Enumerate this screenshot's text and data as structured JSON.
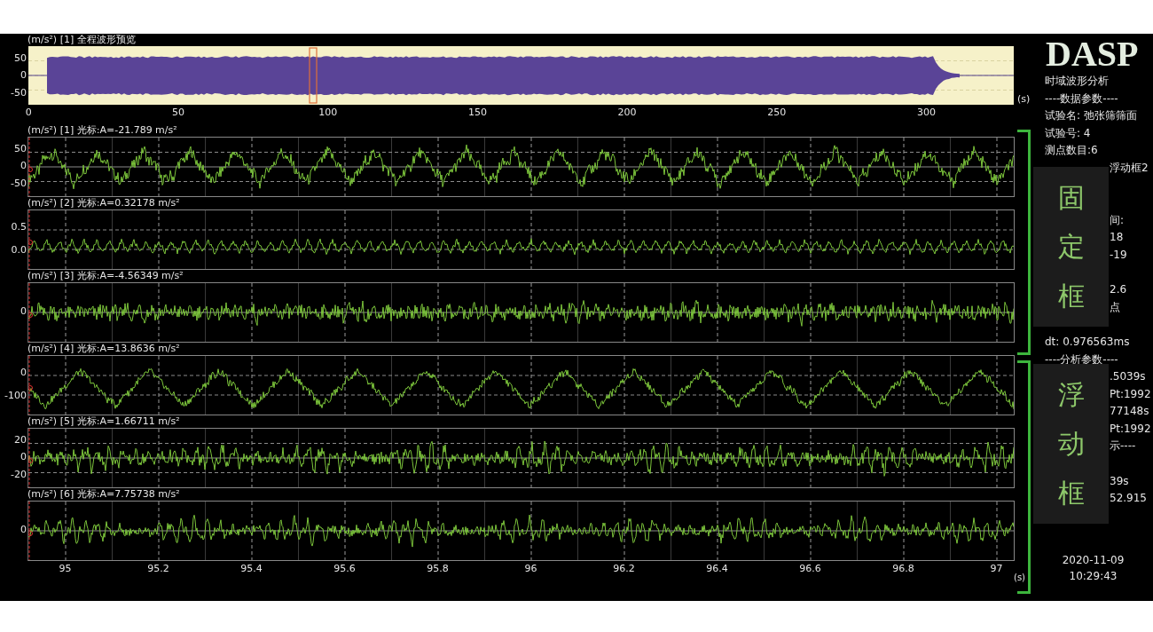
{
  "overview": {
    "label": "(m/s²) [1] 全程波形预览",
    "yticks": [
      "50",
      "0",
      "-50"
    ],
    "xticks": [
      "0",
      "50",
      "100",
      "150",
      "200",
      "250",
      "300"
    ],
    "unit": "(s)"
  },
  "channels": [
    {
      "label": "(m/s²) [1] 光标:A=-21.789 m/s²",
      "yticks": [
        "50",
        "0",
        "-50"
      ]
    },
    {
      "label": "(m/s²) [2] 光标:A=0.32178 m/s²",
      "yticks": [
        "0.5",
        "0.0"
      ]
    },
    {
      "label": "(m/s²) [3] 光标:A=-4.56349 m/s²",
      "yticks": [
        "0"
      ]
    },
    {
      "label": "(m/s²) [4] 光标:A=13.8636 m/s²",
      "yticks": [
        "0",
        "-100"
      ]
    },
    {
      "label": "(m/s²) [5] 光标:A=1.66711 m/s²",
      "yticks": [
        "20",
        "0",
        "-20"
      ]
    },
    {
      "label": "(m/s²) [6] 光标:A=7.75738 m/s²",
      "yticks": [
        "0"
      ]
    }
  ],
  "time_axis": {
    "ticks": [
      "95",
      "95.2",
      "95.4",
      "95.6",
      "95.8",
      "96",
      "96.2",
      "96.4",
      "96.6",
      "96.8",
      "97"
    ],
    "unit": "(s)"
  },
  "info_panel": {
    "logo": "DASP",
    "lines": [
      {
        "kind": "line",
        "text": "时域波形分析"
      },
      {
        "kind": "line",
        "text": "----数据参数----"
      },
      {
        "kind": "line",
        "text": "试验名: 弛张筛筛面"
      },
      {
        "kind": "line",
        "text": "试验号: 4"
      },
      {
        "kind": "line",
        "text": "测点数目:6"
      },
      {
        "kind": "fragment",
        "text": "浮动框2"
      },
      {
        "kind": "fragment",
        "text": "间:"
      },
      {
        "kind": "fragment",
        "text": "18"
      },
      {
        "kind": "fragment",
        "text": "-19"
      },
      {
        "kind": "fragment",
        "text": "2.6"
      },
      {
        "kind": "fragment",
        "text": "点"
      },
      {
        "kind": "line",
        "text": "dt: 0.976563ms"
      },
      {
        "kind": "line",
        "text": "----分析参数----"
      },
      {
        "kind": "fragment",
        "text": ".5039s"
      },
      {
        "kind": "fragment",
        "text": "Pt:1992"
      },
      {
        "kind": "fragment",
        "text": "77148s"
      },
      {
        "kind": "fragment",
        "text": "Pt:1992"
      },
      {
        "kind": "fragment",
        "text": "示----"
      },
      {
        "kind": "fragment",
        "text": "39s"
      },
      {
        "kind": "fragment",
        "text": "52.915"
      }
    ],
    "date": "2020-11-09",
    "time": "10:29:43"
  },
  "overlays": [
    {
      "text": "固定框"
    },
    {
      "text": "浮动框"
    }
  ]
}
